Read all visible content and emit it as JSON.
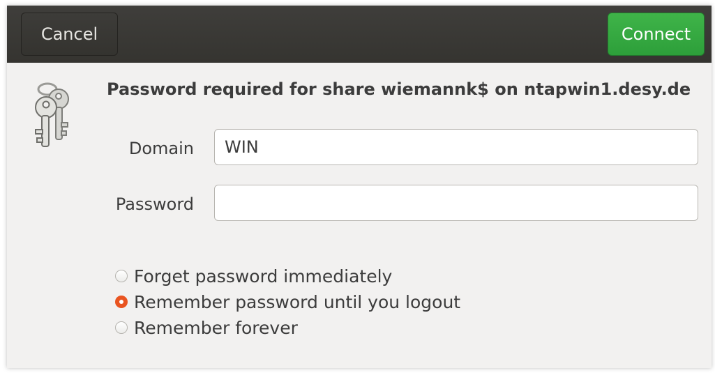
{
  "headerbar": {
    "cancel_label": "Cancel",
    "connect_label": "Connect"
  },
  "icon": "keys-icon",
  "title": "Password required for share wiemannk$ on ntapwin1.desy.de",
  "form": {
    "domain_label": "Domain",
    "domain_value": "WIN",
    "password_label": "Password",
    "password_value": ""
  },
  "remember_options": [
    {
      "label": "Forget password immediately",
      "selected": false
    },
    {
      "label": "Remember password until you logout",
      "selected": true
    },
    {
      "label": "Remember forever",
      "selected": false
    }
  ],
  "colors": {
    "headerbar": "#393834",
    "connect_button": "#38ab45",
    "radio_accent": "#e95420",
    "dialog_background": "#f2f1f0"
  }
}
